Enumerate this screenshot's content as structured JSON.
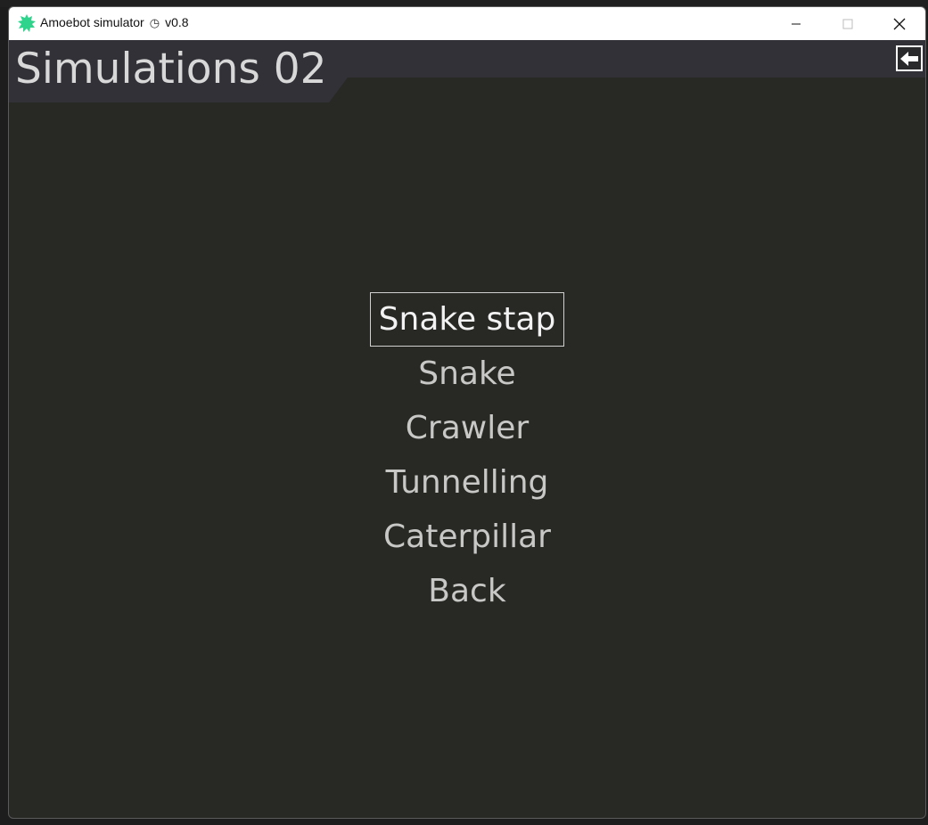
{
  "window": {
    "title": "Amoebot simulator",
    "version": "v0.8",
    "clock_icon": "clock-icon",
    "app_icon": "amoeba-icon",
    "app_icon_color": "#2fd48c"
  },
  "header": {
    "title": "Simulations 02",
    "back_icon": "arrow-left-icon"
  },
  "menu": {
    "items": [
      {
        "label": "Snake stap",
        "selected": true
      },
      {
        "label": "Snake",
        "selected": false
      },
      {
        "label": "Crawler",
        "selected": false
      },
      {
        "label": "Tunnelling",
        "selected": false
      },
      {
        "label": "Caterpillar",
        "selected": false
      },
      {
        "label": "Back",
        "selected": false
      }
    ]
  },
  "colors": {
    "background": "#282825",
    "header": "#313137",
    "text": "#c8c8c6",
    "selected_text": "#f2f2f2"
  }
}
